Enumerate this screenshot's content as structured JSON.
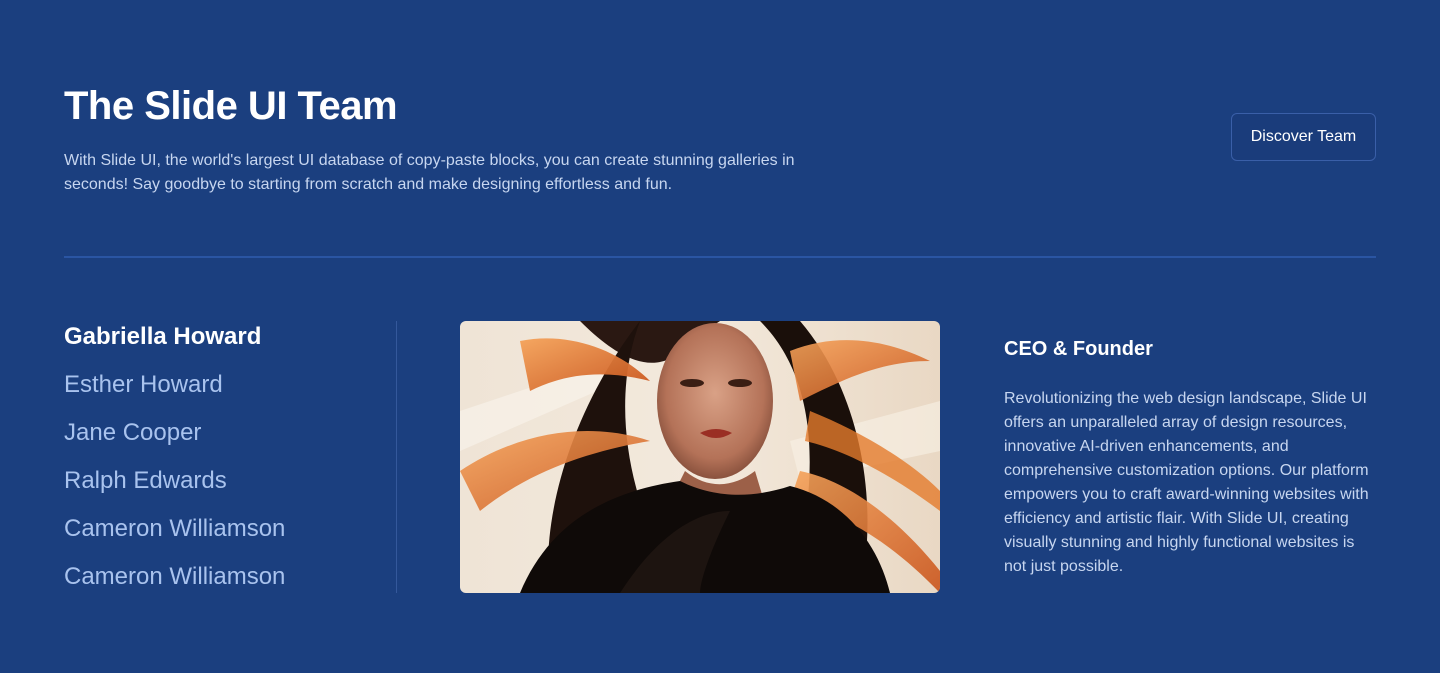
{
  "header": {
    "title": "The Slide UI Team",
    "subtitle": "With Slide UI, the world's largest UI database of copy-paste blocks, you can create stunning galleries in seconds! Say goodbye to starting from scratch and make designing effortless and fun.",
    "discover_label": "Discover Team"
  },
  "team": {
    "members": [
      {
        "name": "Gabriella Howard",
        "active": true
      },
      {
        "name": "Esther Howard",
        "active": false
      },
      {
        "name": "Jane Cooper",
        "active": false
      },
      {
        "name": "Ralph Edwards",
        "active": false
      },
      {
        "name": "Cameron Williamson",
        "active": false
      },
      {
        "name": "Cameron Williamson",
        "active": false
      }
    ]
  },
  "profile": {
    "role": "CEO & Founder",
    "bio": "Revolutionizing the web design landscape, Slide UI offers an unparalleled array of design resources, innovative AI-driven enhancements, and comprehensive customization options. Our platform empowers you to craft award-winning websites with efficiency and artistic flair. With Slide UI, creating visually stunning and highly functional websites is not just possible."
  },
  "colors": {
    "background": "#1b3f7f",
    "accent_text": "#a9c3ee",
    "divider": "#2a55a3"
  }
}
